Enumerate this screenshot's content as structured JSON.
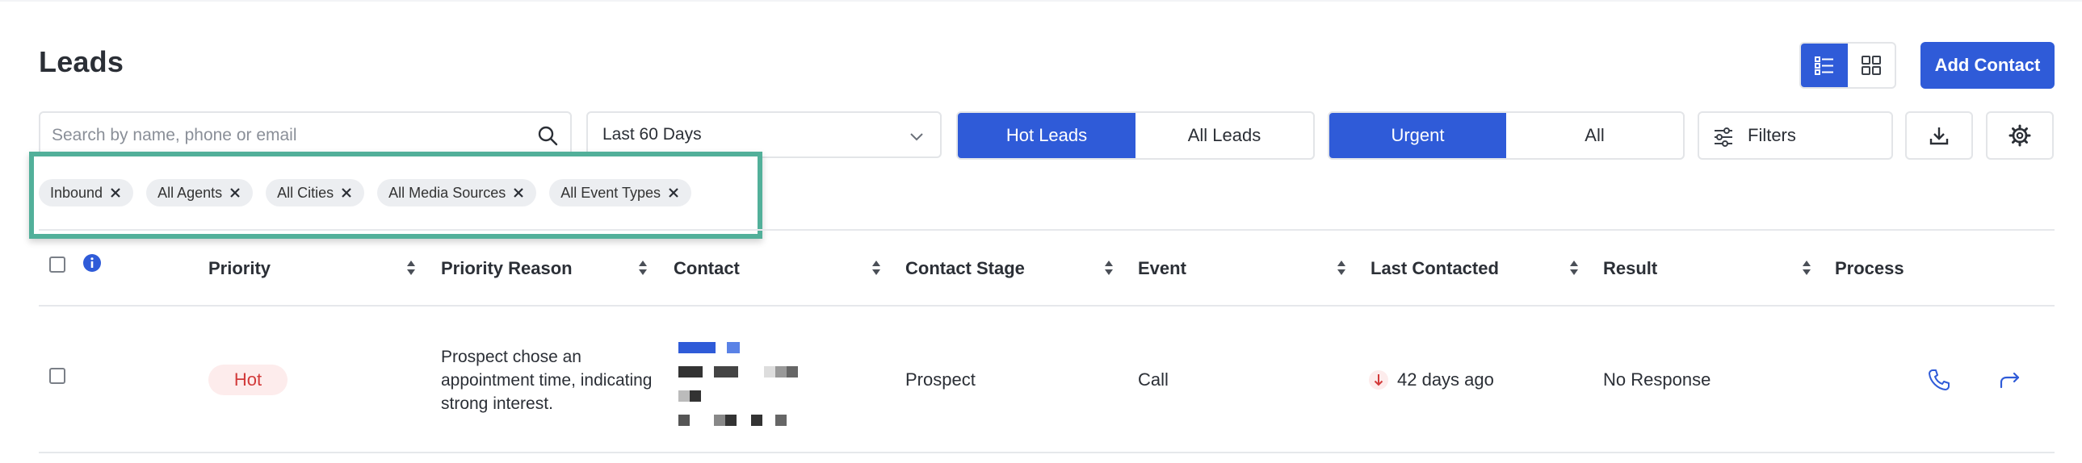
{
  "page": {
    "title": "Leads"
  },
  "header": {
    "add_contact_label": "Add Contact"
  },
  "toolbar": {
    "search_placeholder": "Search by name, phone or email",
    "date_range": "Last 60 Days",
    "lead_segment": [
      "Hot Leads",
      "All Leads"
    ],
    "urgency_segment": [
      "Urgent",
      "All"
    ],
    "filters_label": "Filters"
  },
  "chips": [
    "Inbound",
    "All Agents",
    "All Cities",
    "All Media Sources",
    "All Event Types"
  ],
  "table": {
    "columns": [
      "Priority",
      "Priority Reason",
      "Contact",
      "Contact Stage",
      "Event",
      "Last Contacted",
      "Result",
      "Process"
    ],
    "rows": [
      {
        "priority": "Hot",
        "priority_reason": "Prospect chose an appointment time, indicating strong interest.",
        "contact_stage": "Prospect",
        "event": "Call",
        "last_contacted": "42 days ago",
        "result": "No Response"
      }
    ]
  },
  "colors": {
    "accent": "#2f5bd8",
    "highlight_border": "#52b09a",
    "hot_text": "#d23a3a",
    "hot_bg": "#fdecec"
  },
  "icons": [
    "search-icon",
    "chevron-down-icon",
    "list-view-icon",
    "grid-view-icon",
    "sliders-icon",
    "download-icon",
    "gear-icon",
    "close-icon",
    "info-icon",
    "sort-icon",
    "arrow-down-icon",
    "phone-icon",
    "redirect-icon"
  ]
}
